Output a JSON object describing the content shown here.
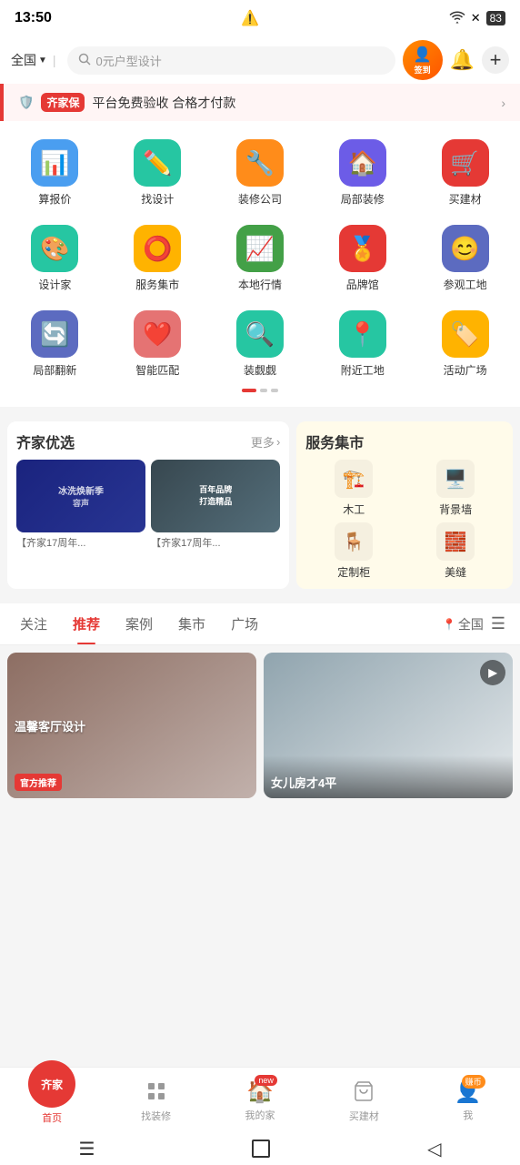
{
  "statusBar": {
    "time": "13:50",
    "battery": "83"
  },
  "header": {
    "location": "全国",
    "searchPlaceholder": "0元户型设计",
    "signLabel": "签到"
  },
  "qijiaBanner": {
    "brand": "齐家保",
    "text": "平台免费验收 合格才付款",
    "arrow": "›"
  },
  "iconGrid": {
    "row1": [
      {
        "id": "calc",
        "label": "算报价",
        "color": "#4a9ef0",
        "emoji": "📊"
      },
      {
        "id": "design",
        "label": "找设计",
        "color": "#26c6a2",
        "emoji": "✏️"
      },
      {
        "id": "company",
        "label": "装修公司",
        "color": "#ff8c1a",
        "emoji": "🔧"
      },
      {
        "id": "local",
        "label": "局部装修",
        "color": "#6c5ce7",
        "emoji": "🏠"
      },
      {
        "id": "material",
        "label": "买建材",
        "color": "#e53935",
        "emoji": "🛒"
      }
    ],
    "row2": [
      {
        "id": "designer",
        "label": "设计家",
        "color": "#26c6a2",
        "emoji": "🎨"
      },
      {
        "id": "service",
        "label": "服务集市",
        "color": "#ffb300",
        "emoji": "⭕"
      },
      {
        "id": "local-info",
        "label": "本地行情",
        "color": "#43a047",
        "emoji": "📈"
      },
      {
        "id": "brand",
        "label": "品牌馆",
        "color": "#e53935",
        "emoji": "🏅"
      },
      {
        "id": "visit",
        "label": "参观工地",
        "color": "#5c6bc0",
        "emoji": "😊"
      }
    ],
    "row3": [
      {
        "id": "renovate",
        "label": "局部翻新",
        "color": "#5c6bc0",
        "emoji": "🔄"
      },
      {
        "id": "smart",
        "label": "智能匹配",
        "color": "#e57373",
        "emoji": "❤️"
      },
      {
        "id": "look",
        "label": "装觑觑",
        "color": "#26c6a2",
        "emoji": "🏠"
      },
      {
        "id": "nearby",
        "label": "附近工地",
        "color": "#26c6a2",
        "emoji": "📍"
      },
      {
        "id": "activity",
        "label": "活动广场",
        "color": "#ffb300",
        "emoji": "🏷️"
      }
    ]
  },
  "youxuan": {
    "title": "齐家优选",
    "moreLabel": "更多",
    "products": [
      {
        "id": "p1",
        "desc": "【齐家17周年...",
        "bg": "#1a237e",
        "text": "冰洗焕新季"
      },
      {
        "id": "p2",
        "desc": "【齐家17周年...",
        "bg": "#37474f",
        "text": "百年品牌 打造精品"
      }
    ]
  },
  "serviceMarket": {
    "title": "服务集市",
    "items": [
      {
        "id": "carpenter",
        "label": "木工",
        "emoji": "🏗️"
      },
      {
        "id": "bgwall",
        "label": "背景墙",
        "emoji": "🖥️"
      },
      {
        "id": "cabinet",
        "label": "定制柜",
        "emoji": "🪑"
      },
      {
        "id": "grout",
        "label": "美缝",
        "emoji": "🧱"
      }
    ]
  },
  "tabs": {
    "items": [
      {
        "id": "follow",
        "label": "关注",
        "active": false
      },
      {
        "id": "recommend",
        "label": "推荐",
        "active": true
      },
      {
        "id": "case",
        "label": "案例",
        "active": false
      },
      {
        "id": "market",
        "label": "集市",
        "active": false
      },
      {
        "id": "square",
        "label": "广场",
        "active": false
      }
    ],
    "location": "全国",
    "menuIcon": "☰"
  },
  "feed": {
    "items": [
      {
        "id": "f1",
        "officialBadge": "官方推荐",
        "bg": "#8d6e63"
      },
      {
        "id": "f2",
        "overlayText": "女儿房才4平",
        "bg": "#90a4ae",
        "hasPlay": true
      }
    ]
  },
  "bottomNav": {
    "items": [
      {
        "id": "home",
        "label": "首页",
        "emoji": "齐家",
        "active": true,
        "isHome": true
      },
      {
        "id": "find",
        "label": "找装修",
        "emoji": "💬",
        "active": false
      },
      {
        "id": "myhome",
        "label": "我的家",
        "emoji": "🏠",
        "active": false,
        "badge": "new"
      },
      {
        "id": "buy",
        "label": "买建材",
        "emoji": "🛍️",
        "active": false
      },
      {
        "id": "me",
        "label": "我",
        "emoji": "👤",
        "active": false,
        "badge": "赚币"
      }
    ]
  }
}
